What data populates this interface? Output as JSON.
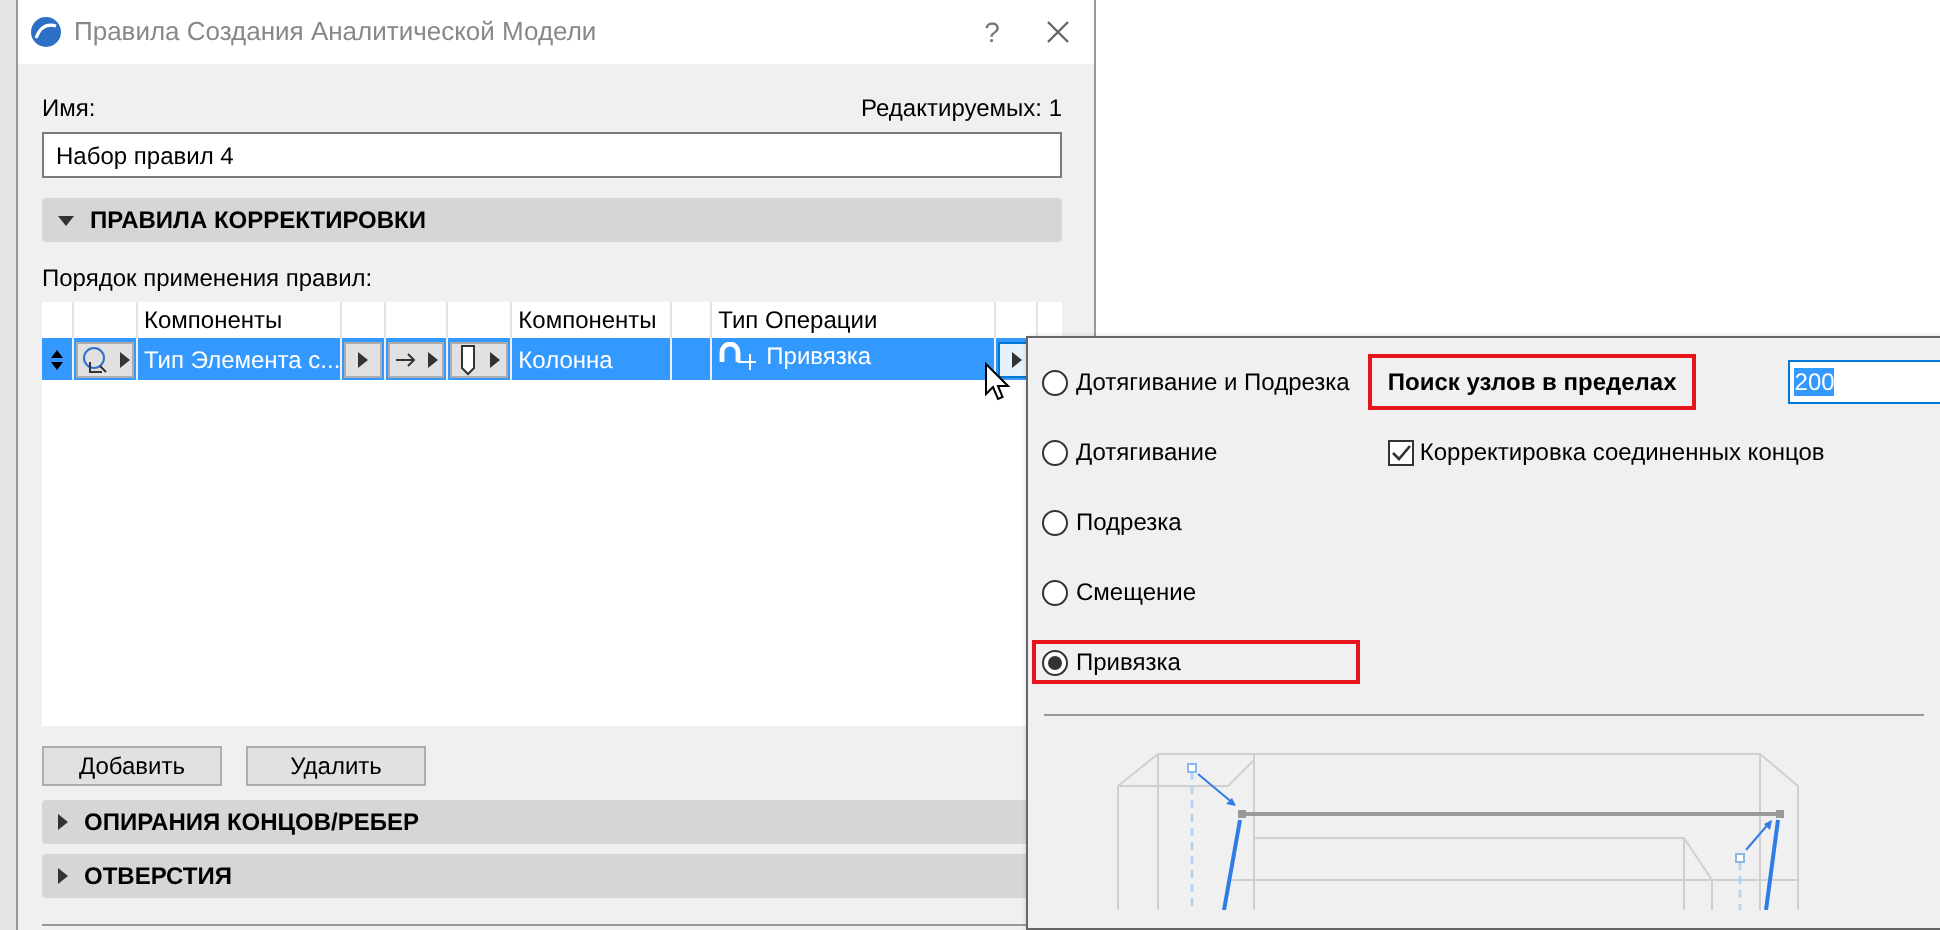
{
  "window": {
    "title": "Правила Создания Аналитической Модели",
    "help": "?"
  },
  "name_label": "Имя:",
  "editable_count": "Редактируемых: 1",
  "name_field": {
    "value": "Набор правил 4"
  },
  "correction_section": {
    "title": "ПРАВИЛА КОРРЕКТИРОВКИ",
    "expanded": true
  },
  "order_label": "Порядок применения правил:",
  "rules_table": {
    "column_headers": [
      "Компоненты",
      "Компоненты",
      "Тип Операции"
    ],
    "rows": [
      {
        "selected": true,
        "source": "Тип Элемента с...",
        "target": "Колонна",
        "operation": "Привязка"
      }
    ]
  },
  "buttons": [
    "Добавить",
    "Удалить"
  ],
  "other_sections": [
    {
      "title": "ОПИРАНИЯ КОНЦОВ/РЕБЕР",
      "expanded": false
    },
    {
      "title": "ОТВЕРСТИЯ",
      "expanded": false
    }
  ],
  "operation_popup": {
    "options": [
      {
        "label": "Дотягивание и Подрезка",
        "selected": false,
        "highlighted": false
      },
      {
        "label": "Дотягивание",
        "selected": false,
        "highlighted": false
      },
      {
        "label": "Подрезка",
        "selected": false,
        "highlighted": false
      },
      {
        "label": "Смещение",
        "selected": false,
        "highlighted": false
      },
      {
        "label": "Привязка",
        "selected": true,
        "highlighted": true
      }
    ],
    "search_label": {
      "text": "Поиск узлов в пределах",
      "highlighted": true
    },
    "search_value": "200",
    "correct_ends": {
      "label": "Корректировка соединенных концов",
      "checked": true
    }
  }
}
